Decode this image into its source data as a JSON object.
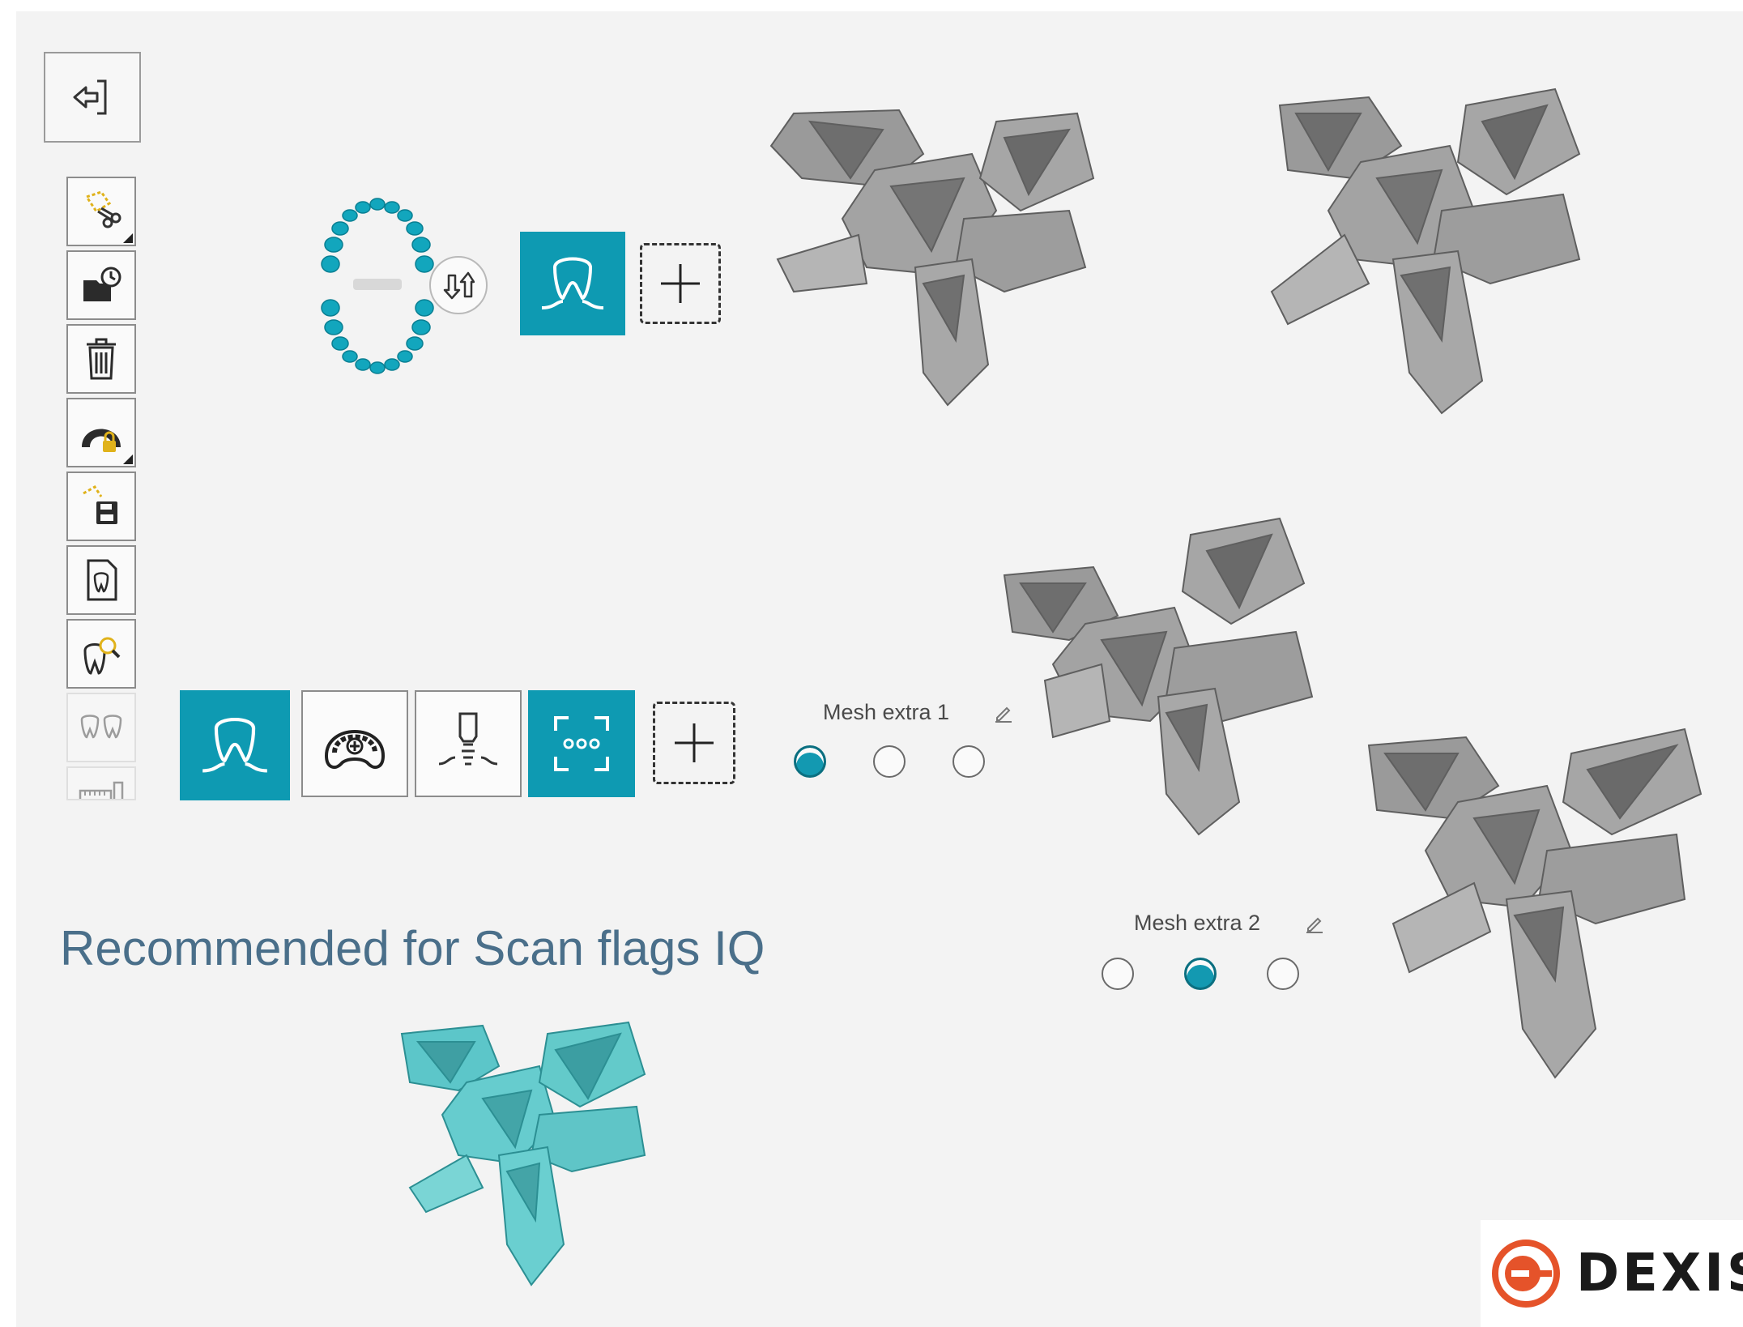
{
  "app": {
    "heading": "Recommended for Scan flags IQ",
    "logo_text": "DEXIS",
    "logo_mark": "e-logo-icon",
    "accent_color": "#0e9ab2",
    "model_color": "#8c8c8c",
    "highlight_model_color": "#5cc6c9"
  },
  "toolbar": {
    "exit": "exit-icon",
    "tools": [
      {
        "name": "trim-scissors-icon"
      },
      {
        "name": "restore-history-icon"
      },
      {
        "name": "trash-icon"
      },
      {
        "name": "lock-arch-icon"
      },
      {
        "name": "save-selection-icon"
      },
      {
        "name": "tooth-document-icon"
      },
      {
        "name": "tooth-magnify-icon"
      },
      {
        "name": "tooth-pair-icon"
      },
      {
        "name": "ruler-icon"
      }
    ]
  },
  "mesh_extra_1": {
    "label": "Mesh extra 1",
    "selected_index": 0,
    "options": 3
  },
  "mesh_extra_2": {
    "label": "Mesh extra 2",
    "selected_index": 1,
    "options": 3
  }
}
